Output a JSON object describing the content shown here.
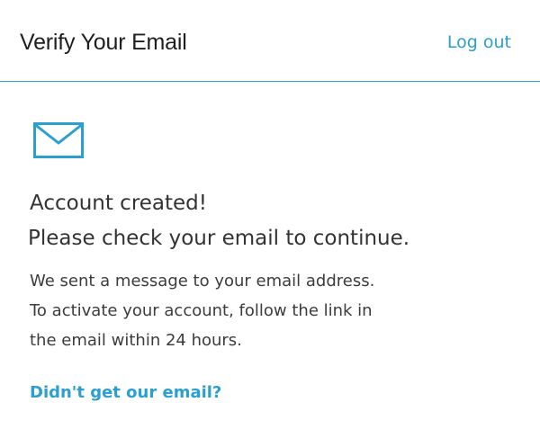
{
  "header": {
    "title": "Verify Your Email",
    "logout_label": "Log out"
  },
  "main": {
    "icon": "envelope-icon",
    "heading_line_1": "Account created!",
    "heading_line_2": "Please check your email to continue.",
    "body_lines": [
      "We sent a message to your email address.",
      "To activate your account, follow the link in",
      "the email within 24 hours."
    ],
    "resend_link_label": "Didn't get our email?"
  },
  "colors": {
    "accent": "#2a9fd0",
    "heading": "#333333",
    "body": "#3c3c3c"
  }
}
